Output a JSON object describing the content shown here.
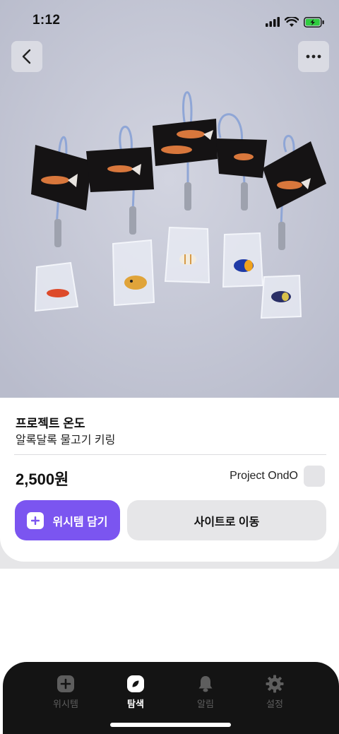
{
  "status_bar": {
    "time": "1:12"
  },
  "product": {
    "brand": "프로젝트 온도",
    "name": "알록달록 물고기 키링",
    "price": "2,500원",
    "seller": "Project OndO"
  },
  "actions": {
    "wish_label": "위시템 담기",
    "site_label": "사이트로 이동"
  },
  "tabs": [
    {
      "label": "위시템",
      "icon": "plus-square-icon",
      "active": false
    },
    {
      "label": "탐색",
      "icon": "compass-leaf-icon",
      "active": true
    },
    {
      "label": "알림",
      "icon": "bell-icon",
      "active": false
    },
    {
      "label": "설정",
      "icon": "gear-icon",
      "active": false
    }
  ],
  "colors": {
    "accent": "#7b55f0",
    "tab_bar_bg": "#141414",
    "secondary_button_bg": "#e6e6e8",
    "battery_charging": "#2fcc3f"
  }
}
